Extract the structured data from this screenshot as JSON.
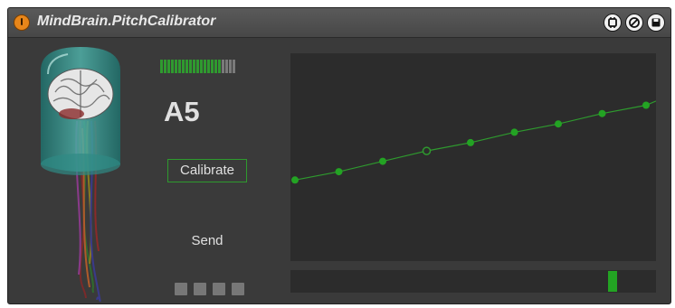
{
  "device": {
    "title": "MindBrain.PitchCalibrator"
  },
  "icons": {
    "power": "power-icon",
    "header_right": [
      "link-icon",
      "cycle-icon",
      "save-icon"
    ],
    "illustration": "brain-jellyfish-illustration"
  },
  "colors": {
    "accent_green": "#2e9a2e",
    "power_orange": "#e8861a",
    "panel": "#3a3a3a",
    "display": "#2c2c2c"
  },
  "level_meter": {
    "segments_total": 21,
    "segments_lit": 17
  },
  "note_display": "A5",
  "buttons": {
    "calibrate": "Calibrate",
    "send": "Send"
  },
  "indicators": {
    "count": 4
  },
  "graph": {
    "points": [
      {
        "index": 0,
        "value": 0.39,
        "selected": false
      },
      {
        "index": 1,
        "value": 0.43,
        "selected": false
      },
      {
        "index": 2,
        "value": 0.48,
        "selected": false
      },
      {
        "index": 3,
        "value": 0.53,
        "selected": true
      },
      {
        "index": 4,
        "value": 0.57,
        "selected": false
      },
      {
        "index": 5,
        "value": 0.62,
        "selected": false
      },
      {
        "index": 6,
        "value": 0.66,
        "selected": false
      },
      {
        "index": 7,
        "value": 0.71,
        "selected": false
      },
      {
        "index": 8,
        "value": 0.75,
        "selected": false
      }
    ],
    "line_end_value": 0.77
  },
  "pitch_slider": {
    "position": 0.88
  }
}
